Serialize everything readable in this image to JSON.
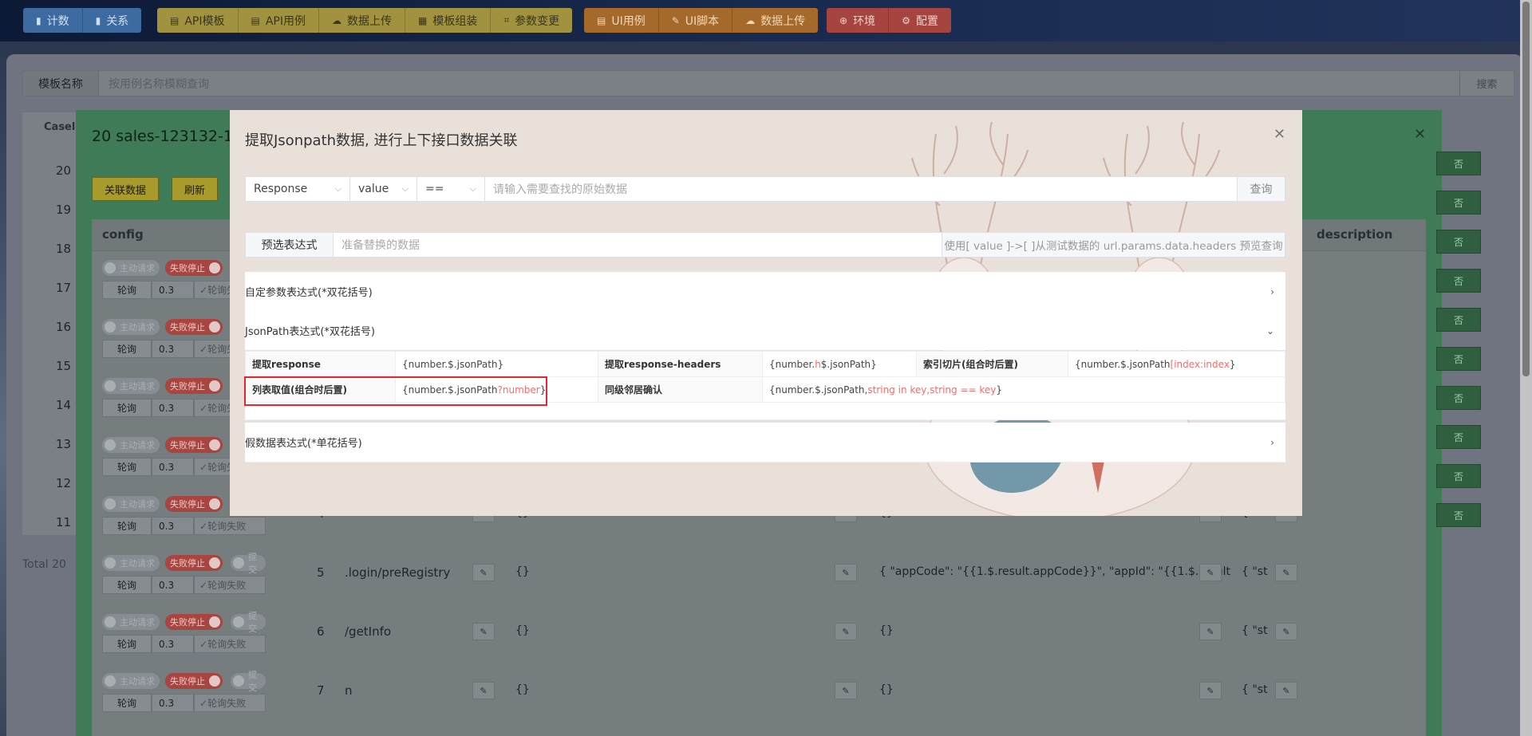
{
  "topnav": {
    "group_blue": [
      {
        "icon": "bar-chart-icon",
        "label": "计数"
      },
      {
        "icon": "bar-chart-icon",
        "label": "关系"
      }
    ],
    "group_yellow": [
      {
        "icon": "file-icon",
        "label": "API模板"
      },
      {
        "icon": "file-icon",
        "label": "API用例"
      },
      {
        "icon": "cloud-upload-icon",
        "label": "数据上传"
      },
      {
        "icon": "grid-icon",
        "label": "模板组装"
      },
      {
        "icon": "crop-icon",
        "label": "参数变更"
      }
    ],
    "group_orange": [
      {
        "icon": "file-icon",
        "label": "UI用例"
      },
      {
        "icon": "edit-icon",
        "label": "UI脚本"
      },
      {
        "icon": "cloud-upload-icon",
        "label": "数据上传"
      }
    ],
    "group_red": [
      {
        "icon": "plus-circle-icon",
        "label": "环境"
      },
      {
        "icon": "gear-icon",
        "label": "配置"
      }
    ]
  },
  "search": {
    "label": "模板名称",
    "placeholder": "按用例名称模糊查询",
    "button": "搜索"
  },
  "background": {
    "case_header": "Casel",
    "total": "Total 20"
  },
  "green_dialog": {
    "title": "20 sales-123132-123",
    "buttons": {
      "link": "关联数据",
      "refresh": "刷新"
    },
    "columns": {
      "config": "config",
      "description": "description"
    },
    "row_numbers": [
      "20",
      "19",
      "18",
      "17",
      "16",
      "15",
      "14",
      "13",
      "12",
      "11"
    ],
    "toggle_off": "主动请求",
    "toggle_fail": "失败停止",
    "toggle_extra": "提交",
    "poll_label": "轮询",
    "poll_value": "0.3",
    "poll_fail": "轮询失败",
    "rows": [
      {
        "id": "4",
        "path": "",
        "body": "{}",
        "mid": "{}",
        "tail": "{ \"st"
      },
      {
        "id": "5",
        "path": ".login/preRegistry",
        "body": "{}",
        "mid": "{ \"appCode\": \"{{1.$.result.appCode}}\", \"appId\": \"{{1.$.result",
        "tail": "{ \"st"
      },
      {
        "id": "6",
        "path": "/getInfo",
        "body": "{}",
        "mid": "{}",
        "tail": "{ \"st"
      },
      {
        "id": "7",
        "path": "n",
        "body": "{}",
        "mid": "{}",
        "tail": "{ \"st"
      }
    ],
    "side_btn": "否"
  },
  "modal": {
    "title": "提取Jsonpath数据, 进行上下接口数据关联",
    "query": {
      "source": "Response",
      "field": "value",
      "operator": "==",
      "placeholder": "请输入需要查找的原始数据",
      "button": "查询"
    },
    "preview": {
      "button": "预选表达式",
      "placeholder": "准备替换的数据",
      "hint": "使用[ value ]->[ ]从测试数据的 url.params.data.headers 预览查询"
    },
    "sections": {
      "custom": "自定参数表达式(*双花括号)",
      "jsonpath": "JsonPath表达式(*双花括号)",
      "fake": "假数据表达式(*单花括号)"
    },
    "table": {
      "r1": {
        "l1": "提取response",
        "v1": "{number.$.jsonPath}",
        "l2": "提取response-headers",
        "v2a": "{number.",
        "v2b": "h",
        "v2c": "$.jsonPath}",
        "l3": "索引切片(组合时后置)",
        "v3a": "{number.$.jsonPath",
        "v3b": "[index:index",
        "v3c": "}"
      },
      "r2": {
        "l1": "列表取值(组合时后置)",
        "v1a": "{number.$.jsonPath",
        "v1b": "?number",
        "v1c": "}",
        "l2": "同级邻居确认",
        "v2a": "{number.$.jsonPath,",
        "v2b": "string in key,string == key",
        "v2c": "}"
      }
    }
  }
}
